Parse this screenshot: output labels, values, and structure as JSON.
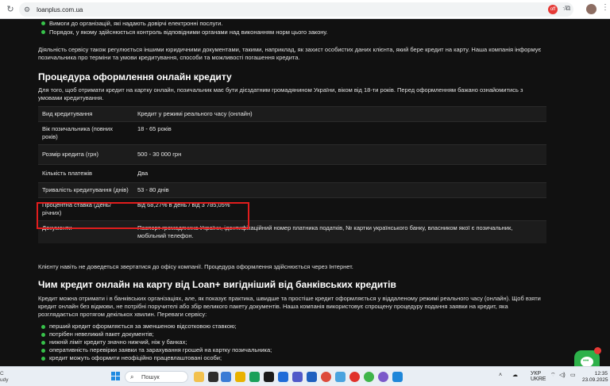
{
  "browser": {
    "url": "loanplus.com.ua",
    "extension_badge": "off"
  },
  "page": {
    "bullets_top": [
      "Вимоги до організацій, які надають довірчі електронні послуги.",
      "Порядок, у якому здійснюється контроль відповідними органами над виконанням норм цього закону."
    ],
    "intro_para": "Діяльність сервісу також регулюється іншими юридичними документами, такими, наприклад, як захист особистих даних клієнта, який бере кредит на карту. Наша компанія інформує позичальника про терміни та умови кредитування, способи та можливості погашення кредита.",
    "section1_title": "Процедура оформлення онлайн кредиту",
    "section1_para": "Для того, щоб отримати кредит на картку онлайн, позичальник має бути дієздатним громадянином України, віком від 18-ти років. Перед оформленням бажано ознайомитись з умовами кредитування.",
    "table": [
      {
        "label": "Вид кредитування",
        "value": "Кредит у режимі реального часу (онлайн)"
      },
      {
        "label": "Вік позичальника (повних років)",
        "value": "18 - 65 років"
      },
      {
        "label": "Розмір кредита (грн)",
        "value": "500 - 30 000 грн"
      },
      {
        "label": "Кількість платежів",
        "value": "Два"
      },
      {
        "label": "Тривалість кредитування (днів)",
        "value": "53 - 80 днів"
      },
      {
        "label": "Процентна ставка (День/річних)",
        "value": "від 68,27% в день / від 3 785,05%"
      },
      {
        "label": "Документи",
        "value": "Паспорт громадянина України, ідентифікаційний номер платника податків, № картки українського банку, власником якої є позичальник, мобільний телефон."
      }
    ],
    "after_table_para": "Клієнту навіть не доведеться звертатися до офісу компанії. Процедура оформлення здійснюється через Інтернет.",
    "section2_title": "Чим кредит онлайн на карту від Loan+ вигідніший від банківських кредитів",
    "section2_para": "Кредит можна отримати і в банківських організаціях, але, як показує практика, швидше та простіше кредит оформляється у віддаленому режимі реального часу (онлайн). Щоб взяти кредит онлайн без відмови, не потрібні поручителі або збір великого пакету документів. Наша компанія використовує спрощену процедуру подання заявки на кредит, яка розглядається протягом декількох хвилин. Переваги сервісу:",
    "bullets_bottom": [
      "перший кредит оформляється за зменшеною відсотковою ставкою;",
      "потрібен невеликий пакет документів;",
      "нижній ліміт кредиту значно нижчий, ніж у банках;",
      "оперативність перевірки заявки та зарахування грошей на картку позичальника;",
      "кредит можуть оформити неофіційно працевлаштовані особи;"
    ]
  },
  "taskbar": {
    "search_placeholder": "Пошук",
    "lang_top": "УКР",
    "lang_bottom": "UKRE",
    "time": "12:35",
    "date": "23.09.2025",
    "left_stub_top": "C",
    "left_stub_bottom": "udy"
  },
  "colors": {
    "accent_green": "#2db14a",
    "highlight_red": "#e11d1d",
    "page_bg": "#111111"
  }
}
